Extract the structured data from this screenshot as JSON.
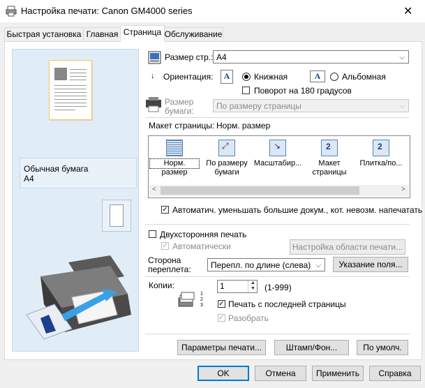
{
  "window": {
    "title": "Настройка печати: Canon GM4000 series",
    "close_glyph": "✕"
  },
  "tabs": [
    {
      "label": "Быстрая установка"
    },
    {
      "label": "Главная"
    },
    {
      "label": "Страница"
    },
    {
      "label": "Обслуживание"
    }
  ],
  "preview": {
    "media_type": "Обычная бумага",
    "media_size": "A4"
  },
  "page_size": {
    "label": "Размер стр.:",
    "value": "A4"
  },
  "orientation": {
    "label": "Ориентация:",
    "portrait": "Книжная",
    "landscape": "Альбомная",
    "selected": "portrait",
    "rotate_label": "Поворот на 180 градусов",
    "rotate_checked": false
  },
  "paper_size": {
    "label_line1": "Размер",
    "label_line2": "бумаги:",
    "value": "По размеру страницы"
  },
  "page_layout": {
    "label": "Макет страницы:",
    "value": "Норм. размер",
    "items": [
      {
        "line1": "Норм.",
        "line2": "размер",
        "icon": "normal-size-icon"
      },
      {
        "line1": "По размеру",
        "line2": "бумаги",
        "icon": "fit-to-page-icon"
      },
      {
        "line1": "Масштабир...",
        "line2": "",
        "icon": "scaled-icon"
      },
      {
        "line1": "Макет",
        "line2": "страницы",
        "icon": "page-layout-icon"
      },
      {
        "line1": "Плитка/по...",
        "line2": "",
        "icon": "tiling-icon"
      }
    ]
  },
  "auto_reduce": {
    "label": "Автоматич. уменьшать большие докум., кот. невозм. напечатать",
    "checked": true
  },
  "duplex": {
    "label": "Двухсторонняя печать",
    "checked": false,
    "auto_label": "Автоматически",
    "auto_checked": true,
    "area_button": "Настройка области печати..."
  },
  "binding": {
    "label_line1": "Сторона",
    "label_line2": "переплета:",
    "value": "Перепл. по длине (слева)",
    "margin_button": "Указание поля..."
  },
  "copies": {
    "label": "Копии:",
    "value": "1",
    "range": "(1-999)",
    "last_page_label": "Печать с последней страницы",
    "last_page_checked": true,
    "collate_label": "Разобрать",
    "collate_checked": true
  },
  "bottom_buttons": {
    "print_options": "Параметры печати...",
    "stamp": "Штамп/Фон...",
    "defaults": "По умолч."
  },
  "dialog_buttons": {
    "ok": "OK",
    "cancel": "Отмена",
    "apply": "Применить",
    "help": "Справка"
  },
  "colors": {
    "accent": "#0078d7",
    "preview_bg": "#e1edf6"
  }
}
